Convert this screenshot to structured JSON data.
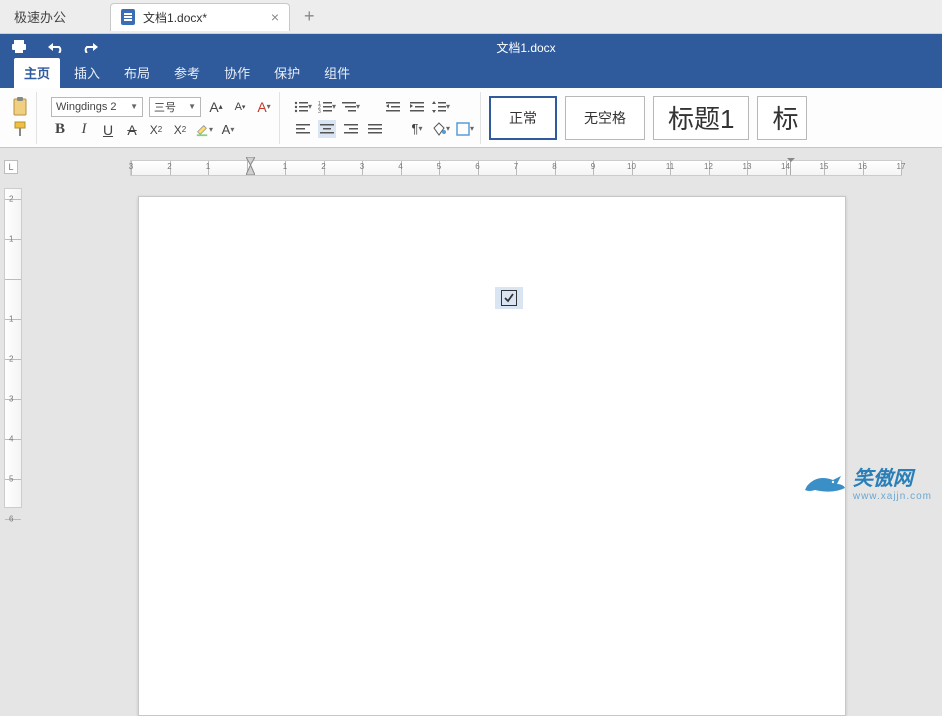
{
  "app": {
    "name": "极速办公"
  },
  "tab": {
    "label": "文档1.docx*"
  },
  "titlebar": {
    "title": "文档1.docx"
  },
  "ribbonTabs": [
    "主页",
    "插入",
    "布局",
    "参考",
    "协作",
    "保护",
    "组件"
  ],
  "font": {
    "name": "Wingdings 2",
    "size": "三号"
  },
  "styles": {
    "normal": "正常",
    "nospace": "无空格",
    "heading1": "标题1",
    "heading_cut": "标"
  },
  "ruler": {
    "h": [
      "3",
      "2",
      "1",
      "",
      "1",
      "2",
      "3",
      "4",
      "5",
      "6",
      "7",
      "8",
      "9",
      "10",
      "11",
      "12",
      "13",
      "14",
      "15",
      "16",
      "17"
    ],
    "v": [
      "2",
      "1",
      "",
      "1",
      "2",
      "3",
      "4",
      "5",
      "6"
    ]
  },
  "corner": "L",
  "document": {
    "content_glyph": "☑"
  },
  "watermark": {
    "brand": "笑傲网",
    "url": "www.xajjn.com"
  }
}
